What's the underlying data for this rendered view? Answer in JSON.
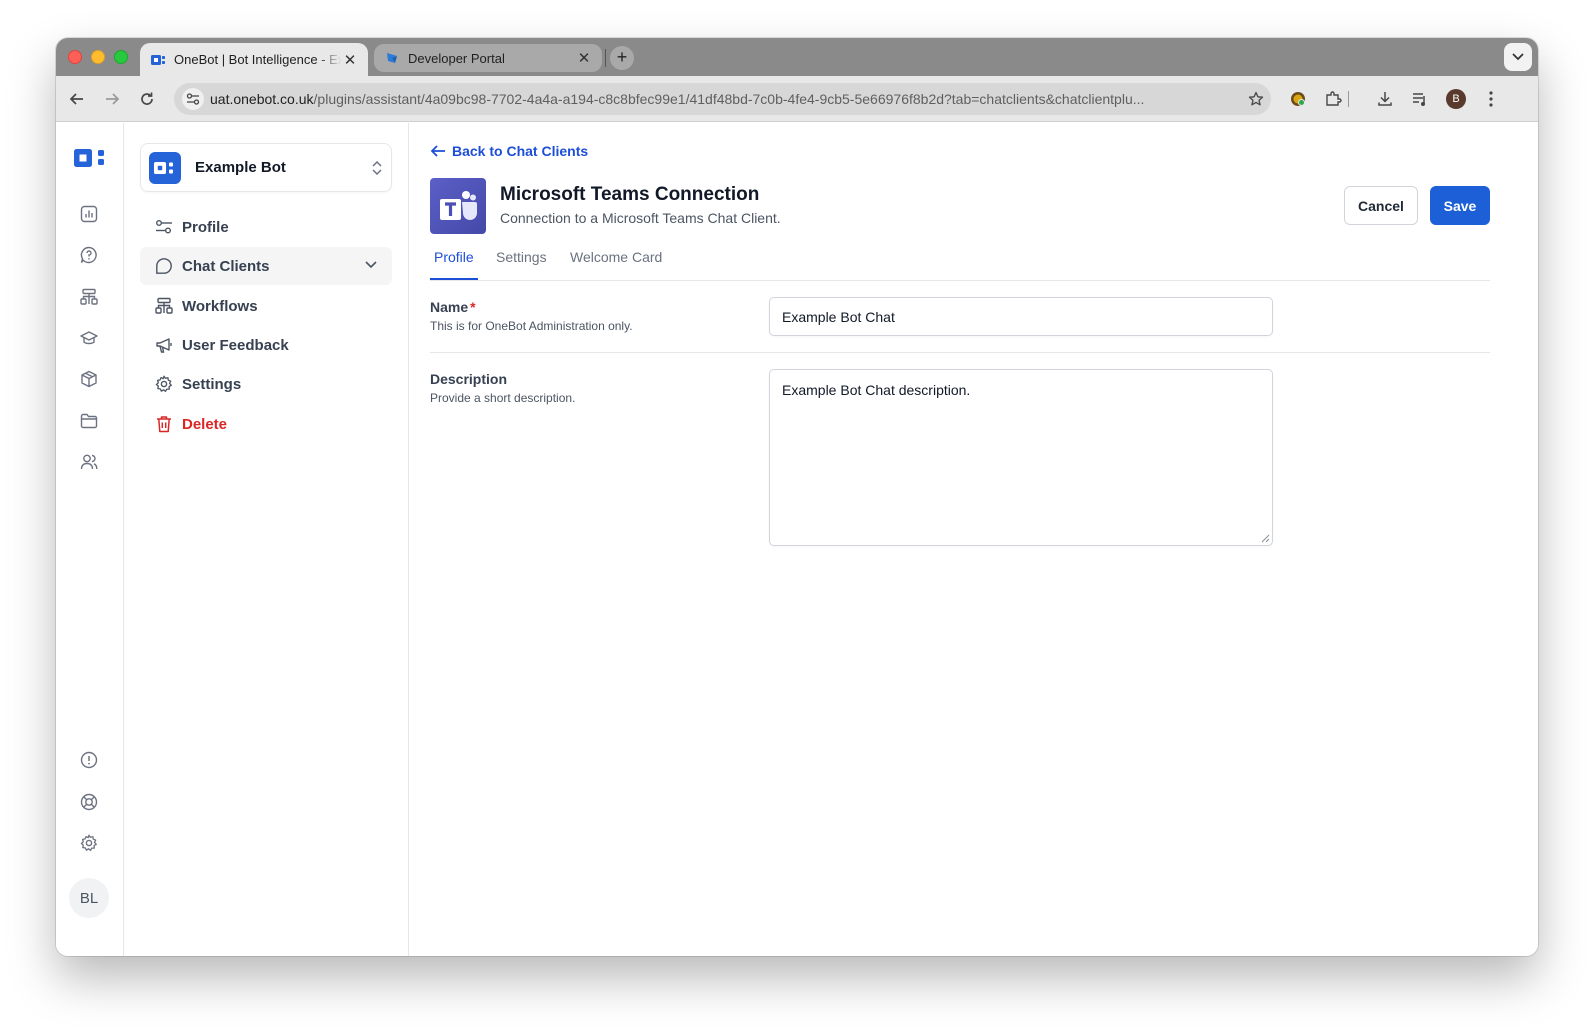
{
  "browser": {
    "tabs": [
      {
        "title": "OneBot | Bot Intelligence - Example Bot",
        "active": true,
        "close": "✕"
      },
      {
        "title": "Developer Portal",
        "active": false,
        "close": "✕"
      }
    ],
    "new_tab": "+",
    "url_host": "uat.onebot.co.uk",
    "url_rest": "/plugins/assistant/4a09bc98-7702-4a4a-a194-c8c8bfec99e1/41df48bd-7c0b-4fe4-9cb5-5e66976f8b2d?tab=chatclients&chatclientplu...",
    "profile_initial": "B"
  },
  "rail": {
    "icons": [
      "analytics-icon",
      "help-chat-icon",
      "workflows-icon",
      "learning-icon",
      "package-icon",
      "folder-icon",
      "users-icon"
    ],
    "bottom_icons": [
      "info-icon",
      "support-icon",
      "settings-icon"
    ],
    "avatar_initials": "BL"
  },
  "subnav": {
    "bot_name": "Example Bot",
    "items": [
      {
        "label": "Profile",
        "icon": "profile-sliders-icon"
      },
      {
        "label": "Chat Clients",
        "icon": "chat-bubble-icon",
        "active": true,
        "expanded": true
      },
      {
        "label": "Workflows",
        "icon": "workflows-icon"
      },
      {
        "label": "User Feedback",
        "icon": "megaphone-icon"
      },
      {
        "label": "Settings",
        "icon": "settings-icon"
      },
      {
        "label": "Delete",
        "icon": "trash-icon",
        "danger": true
      }
    ]
  },
  "main": {
    "back_label": "Back to Chat Clients",
    "title": "Microsoft Teams Connection",
    "subtitle": "Connection to a Microsoft Teams Chat Client.",
    "cancel_label": "Cancel",
    "save_label": "Save",
    "tabs": [
      {
        "label": "Profile",
        "active": true
      },
      {
        "label": "Settings",
        "active": false
      },
      {
        "label": "Welcome Card",
        "active": false
      }
    ],
    "fields": {
      "name": {
        "label": "Name",
        "required_mark": "*",
        "help": "This is for OneBot Administration only.",
        "value": "Example Bot Chat"
      },
      "description": {
        "label": "Description",
        "help": "Provide a short description.",
        "value": "Example Bot Chat description."
      }
    }
  },
  "colors": {
    "accent": "#1d5fd7",
    "link": "#1d4ed8",
    "danger": "#dc2626",
    "teams": "#5b5fc7"
  }
}
